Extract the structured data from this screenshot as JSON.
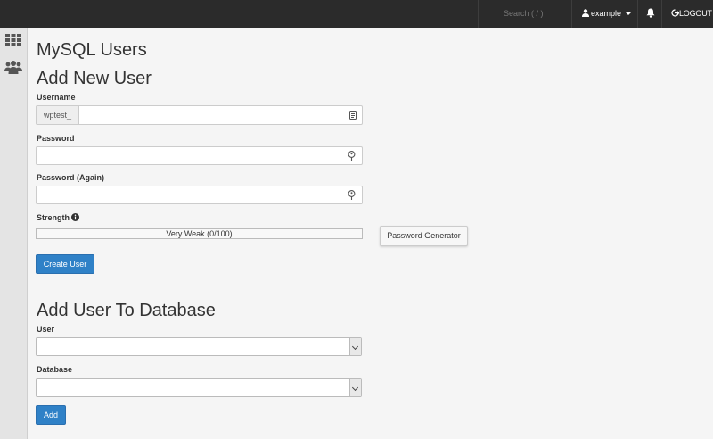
{
  "topbar": {
    "search_placeholder": "Search ( / )",
    "user_name": "example",
    "logout_label": "LOGOUT"
  },
  "sidebar": {
    "icons": [
      "grid-icon",
      "users-icon"
    ]
  },
  "page": {
    "title": "MySQL Users"
  },
  "add_user": {
    "heading": "Add New User",
    "username_label": "Username",
    "username_prefix": "wptest_",
    "username_value": "",
    "password_label": "Password",
    "password_value": "",
    "password_again_label": "Password (Again)",
    "password_again_value": "",
    "strength_label": "Strength",
    "strength_text": "Very Weak (0/100)",
    "strength_score": 0,
    "generator_label": "Password Generator",
    "create_label": "Create User"
  },
  "add_to_db": {
    "heading": "Add User To Database",
    "user_label": "User",
    "user_selected": "",
    "database_label": "Database",
    "database_selected": "",
    "add_label": "Add"
  },
  "colors": {
    "topbar": "#2b2b2b",
    "primary": "#2f81c7",
    "background": "#f5f5f5"
  }
}
